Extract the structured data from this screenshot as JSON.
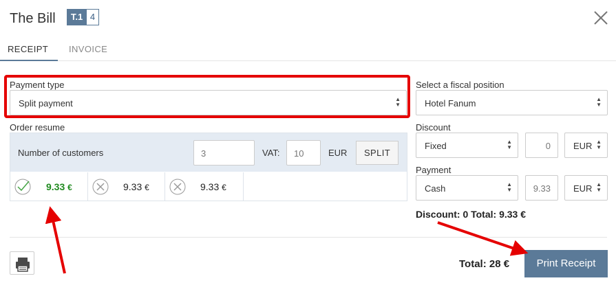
{
  "header": {
    "title": "The Bill",
    "table_badge": "T.1",
    "guests_badge": "4"
  },
  "tabs": [
    {
      "label": "RECEIPT",
      "active": true
    },
    {
      "label": "INVOICE",
      "active": false
    }
  ],
  "payment_type": {
    "label": "Payment type",
    "value": "Split payment"
  },
  "fiscal_position": {
    "label": "Select a fiscal position",
    "value": "Hotel Fanum"
  },
  "order_resume": {
    "label": "Order resume",
    "customers_label": "Number of customers",
    "customers_value": "3",
    "vat_label": "VAT:",
    "vat_value": "10",
    "currency": "EUR",
    "split_label": "SPLIT",
    "splits": [
      {
        "amount": "9.33",
        "currency": "€",
        "status": "paid"
      },
      {
        "amount": "9.33",
        "currency": "€",
        "status": "unpaid"
      },
      {
        "amount": "9.33",
        "currency": "€",
        "status": "unpaid"
      }
    ]
  },
  "discount": {
    "label": "Discount",
    "type": "Fixed",
    "value": "0",
    "currency": "EUR"
  },
  "payment": {
    "label": "Payment",
    "method": "Cash",
    "amount": "9.33",
    "currency": "EUR"
  },
  "summary": "Discount: 0 Total: 9.33 €",
  "footer": {
    "total": "Total: 28 €",
    "print_label": "Print Receipt"
  },
  "colors": {
    "accent": "#5b7a98",
    "highlight": "#e50000",
    "paid": "#1f8a1f"
  }
}
